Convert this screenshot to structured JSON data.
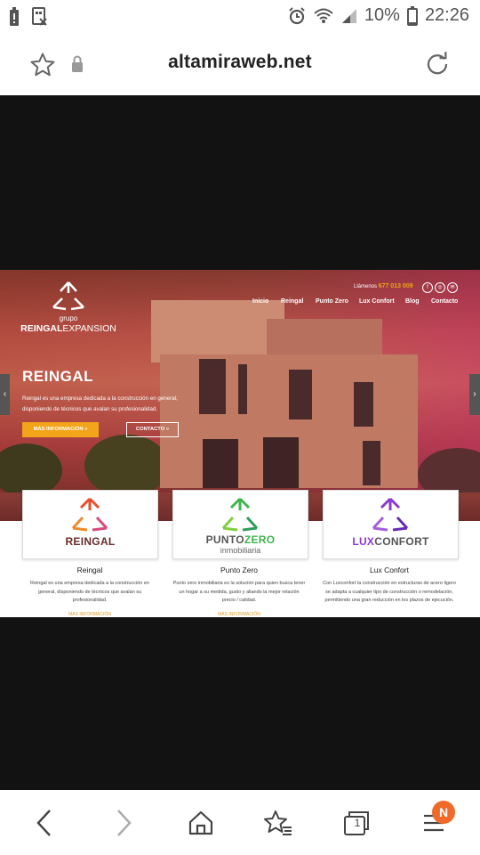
{
  "status_bar": {
    "battery_percent": "10%",
    "time": "22:26"
  },
  "browser": {
    "url": "altamiraweb.net",
    "tab_count": "1",
    "notification_badge": "N"
  },
  "site": {
    "logo": {
      "line1": "grupo",
      "line2a": "REINGAL",
      "line2b": "EXPANSION"
    },
    "phone_label": "Llámenos",
    "phone_number": "677 013 009",
    "nav": [
      "Inicio",
      "Reingal",
      "Punto Zero",
      "Lux Confort",
      "Blog",
      "Contacto"
    ],
    "hero": {
      "title": "REINGAL",
      "text_line1": "Reingal es una empresa dedicada a la construcción en general,",
      "text_line2": "disponiendo de técnicos que avalan su profesionalidad.",
      "btn_more": "MÁS INFORMACIÓN »",
      "btn_contact": "CONTACTO »"
    },
    "cards": [
      {
        "name": "REINGAL",
        "name_b": "",
        "sub": "",
        "color": "#e84e2a"
      },
      {
        "name": "PUNTO",
        "name_b": "ZERO",
        "sub": "inmobiliaria",
        "color": "#3fb54a"
      },
      {
        "name": "LUX",
        "name_b": "CONFORT",
        "sub": "",
        "color": "#8a3bd1"
      }
    ],
    "columns": [
      {
        "title": "Reingal",
        "desc": "Reingal es una empresa dedicada a la construcción en general, disponiendo de técnicos que avalan su profesionalidad.",
        "more": "MÁS INFORMACIÓN"
      },
      {
        "title": "Punto Zero",
        "desc": "Punto zero inmobiliaria es la solución para quien busca tener un hogar a su medida, gusto y aliando la mejor relación precio / calidad.",
        "more": "MÁS INFORMACIÓN"
      },
      {
        "title": "Lux Confort",
        "desc": "Con Luxconfort la construcción en estructuras de acero ligero se adapta a cualquier tipo de construcción o remodelación, permitiendo una gran reducción en los plazos de ejecución.",
        "more": ""
      }
    ]
  },
  "colors": {
    "accent_orange": "#f2a51a",
    "badge": "#f06a2a"
  }
}
